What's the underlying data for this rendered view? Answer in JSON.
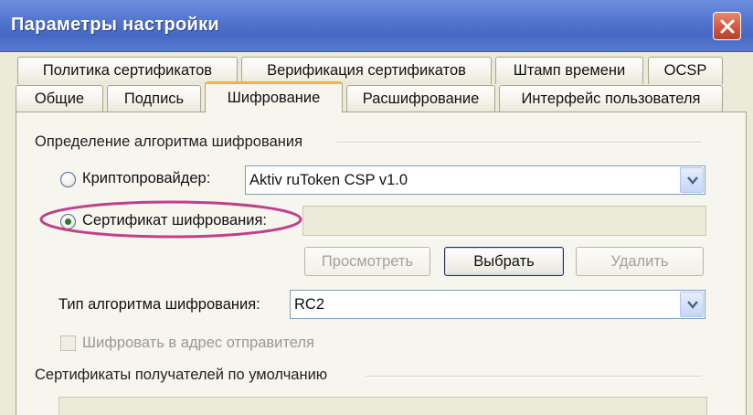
{
  "window": {
    "title": "Параметры настройки"
  },
  "tabs_row1": [
    "Политика сертификатов",
    "Верификация сертификатов",
    "Штамп времени",
    "OCSP"
  ],
  "tabs_row2": [
    "Общие",
    "Подпись",
    "Шифрование",
    "Расшифрование",
    "Интерфейс пользователя"
  ],
  "active_tab": "Шифрование",
  "encryption_algorithm_group": {
    "title": "Определение алгоритма шифрования",
    "crypto_provider": {
      "label": "Криптопровайдер:",
      "selected": false,
      "value": "Aktiv ruToken CSP v1.0"
    },
    "encryption_certificate": {
      "label": "Сертификат шифрования:",
      "selected": true,
      "value": ""
    },
    "buttons": {
      "view": "Просмотреть",
      "select": "Выбрать",
      "delete": "Удалить"
    },
    "algorithm_type": {
      "label": "Тип алгоритма шифрования:",
      "value": "RC2"
    },
    "encrypt_to_sender": {
      "label": "Шифровать в адрес отправителя",
      "checked": false,
      "enabled": false
    }
  },
  "default_recipients_group": {
    "title": "Сертификаты получателей по умолчанию"
  },
  "colors": {
    "titlebar": "#4568c5",
    "highlight": "#c0408a",
    "active_tab_accent": "#f3b24a"
  }
}
